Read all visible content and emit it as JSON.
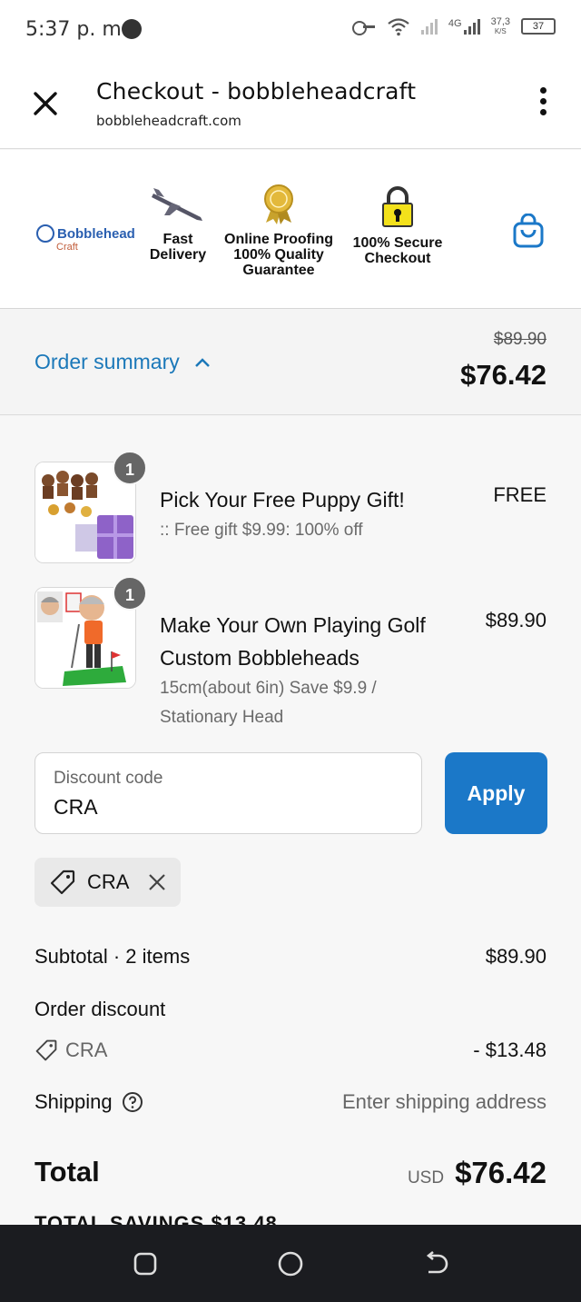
{
  "status_bar": {
    "time": "5:37 p. m.",
    "network": "4G",
    "speed": "37,3",
    "speed_unit": "K/S",
    "battery": "37"
  },
  "header": {
    "title": "Checkout - bobbleheadcraft",
    "url": "bobbleheadcraft.com"
  },
  "banner": {
    "logo_name": "Bobblehead",
    "logo_sub": "Craft",
    "features": [
      {
        "icon": "airplane-icon",
        "line1": "Fast",
        "line2": "Delivery",
        "line3": ""
      },
      {
        "icon": "award-medal-icon",
        "line1": "Online Proofing",
        "line2": "100% Quality",
        "line3": "Guarantee"
      },
      {
        "icon": "padlock-icon",
        "line1": "100% Secure",
        "line2": "Checkout",
        "line3": ""
      }
    ]
  },
  "summary": {
    "label": "Order summary",
    "original_price": "$89.90",
    "total": "$76.42"
  },
  "items": [
    {
      "qty": "1",
      "title": "Pick Your Free Puppy Gift!",
      "sub1": ":: Free gift $9.99: 100% off",
      "sub2": "",
      "price": "FREE"
    },
    {
      "qty": "1",
      "title": "Make Your Own Playing Golf Custom Bobbleheads",
      "sub1": "15cm(about 6in) Save $9.9 /",
      "sub2": "Stationary Head",
      "price": "$89.90"
    }
  ],
  "discount": {
    "label": "Discount code",
    "value": "CRA",
    "apply_label": "Apply",
    "chip_code": "CRA"
  },
  "totals": {
    "subtotal_label": "Subtotal · 2 items",
    "subtotal_value": "$89.90",
    "order_discount_label": "Order discount",
    "discount_code": "CRA",
    "discount_value": "- $13.48",
    "shipping_label": "Shipping",
    "shipping_value": "Enter shipping address",
    "total_label": "Total",
    "currency": "USD",
    "total_value": "$76.42",
    "savings": "TOTAL SAVINGS $13.48"
  },
  "colors": {
    "accent": "#1b78c8",
    "link": "#1b78b9"
  }
}
